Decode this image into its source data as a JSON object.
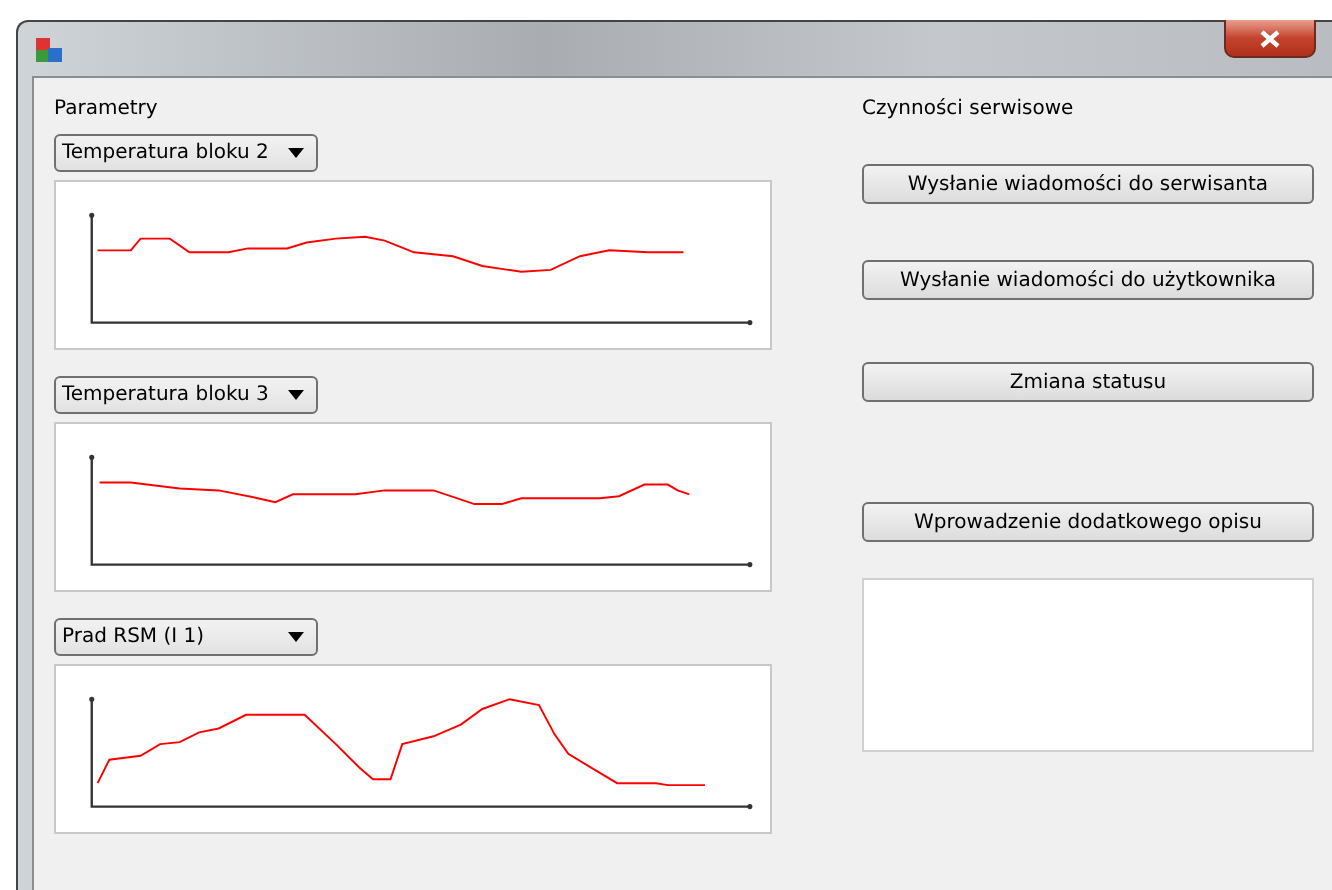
{
  "left_panel": {
    "label": "Parametry",
    "plots": [
      {
        "selector": "Temperatura bloku 2"
      },
      {
        "selector": "Temperatura bloku 3"
      },
      {
        "selector": "Prad RSM (I 1)"
      }
    ]
  },
  "right_panel": {
    "label": "Czynności serwisowe",
    "buttons": [
      {
        "label": "Wysłanie wiadomości do serwisanta"
      },
      {
        "label": "Wysłanie wiadomości do użytkownika"
      },
      {
        "label": "Zmiana statusu"
      },
      {
        "label": "Wprowadzenie dodatkowego opisu"
      }
    ]
  }
}
